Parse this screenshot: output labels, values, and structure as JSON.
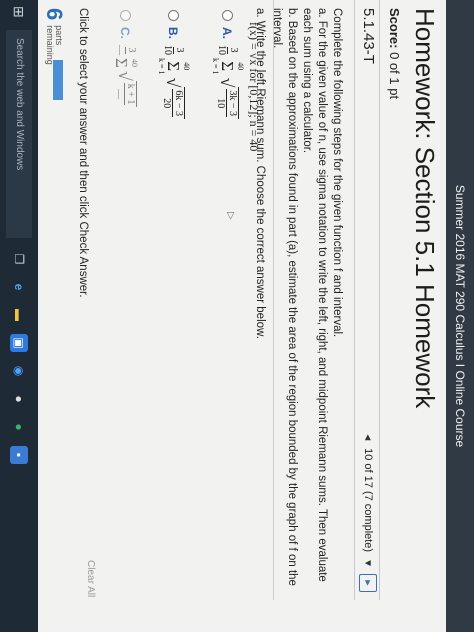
{
  "app_title": "Summer 2016 MAT 290 Calculus I Online Course",
  "page_title": "Homework: Section 5.1 Homework",
  "score": {
    "label": "Score:",
    "value": "0 of 1 pt"
  },
  "question": {
    "id": "5.1.43-T",
    "progress": "10 of 17 (7 complete)",
    "prev_symbol": "◄",
    "dropdown_symbol": "▼",
    "next_symbol": "►"
  },
  "problem": {
    "intro": "Complete the following steps for the given function f and interval.",
    "step_a": "a. For the given value of n, use sigma notation to write the left, right, and midpoint Riemann sums. Then evaluate each sum using a calculator.",
    "step_b": "b. Based on the approximations found in part (a), estimate the area of the region bounded by the graph of f on the interval.",
    "function": "f(x) = √x for [0,12]; n = 40"
  },
  "part_a_prompt": "a. Write the left Riemann sum. Choose the correct answer below.",
  "choices": [
    {
      "letter": "A.",
      "coef_num": "3",
      "coef_den": "10",
      "upper": "40",
      "lower": "k = 1",
      "rad_num": "3k − 3",
      "rad_den": "10"
    },
    {
      "letter": "B.",
      "coef_num": "3",
      "coef_den": "10",
      "upper": "40",
      "lower": "k = 1",
      "rad_num": "6k − 3",
      "rad_den": "20"
    },
    {
      "letter": "C.",
      "coef_num": "3",
      "coef_den": "—",
      "upper": "40",
      "lower": "",
      "rad_num": "k + 1",
      "rad_den": "—"
    }
  ],
  "instructions": "Click to select your answer and then click Check Answer.",
  "parts": {
    "count": "6",
    "line1": "parts",
    "line2": "remaining"
  },
  "clear_all": "Clear All",
  "taskbar": {
    "search_placeholder": "Search the web and Windows"
  },
  "colors": {
    "accent": "#2c5aa0",
    "top_bar": "#2f3a45",
    "taskbar": "#1e2a36",
    "page_bg": "#f2f3f1"
  }
}
